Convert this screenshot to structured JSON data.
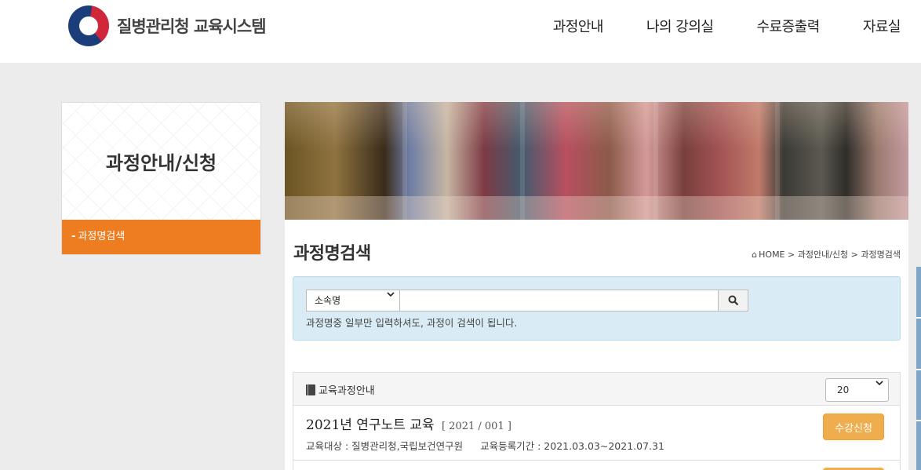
{
  "header": {
    "logo_text": "질병관리청 교육시스템",
    "nav": [
      "과정안내",
      "나의 강의실",
      "수료증출력",
      "자료실"
    ]
  },
  "sidebar": {
    "title": "과정안내/신청",
    "items": [
      {
        "label": "과정명검색",
        "active": true
      }
    ]
  },
  "main": {
    "page_title": "과정명검색",
    "breadcrumb": [
      "HOME",
      "과정안내/신청",
      "과정명검색"
    ],
    "search": {
      "select_value": "소속명",
      "input_value": "",
      "hint": "과정명중 일부만 입력하셔도, 과정이 검색이 됩니다."
    },
    "list": {
      "title": "교육과정안내",
      "page_size": "20",
      "courses": [
        {
          "title": "2021년 연구노트 교육",
          "code": "[ 2021 / 001 ]",
          "target_label": "교육대상 :",
          "target": "질병관리청,국립보건연구원",
          "period_label": "교육등록기간 :",
          "period": "2021.03.03~2021.07.31",
          "button": "수강신청"
        }
      ]
    }
  },
  "colors": {
    "accent_orange": "#ee7d22",
    "button_orange": "#f0ad4e",
    "search_bg": "#d9ecf5"
  }
}
